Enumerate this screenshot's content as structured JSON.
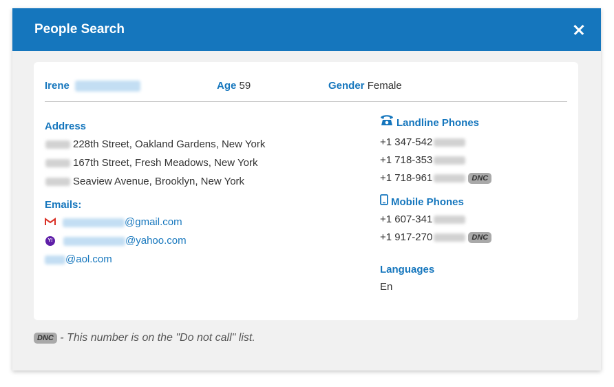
{
  "dialog": {
    "title": "People Search",
    "close_icon": "close-icon"
  },
  "person": {
    "first_name": "Irene",
    "age_label": "Age",
    "age": "59",
    "gender_label": "Gender",
    "gender": "Female"
  },
  "address": {
    "title": "Address",
    "lines": [
      "228th Street, Oakland Gardens, New York",
      "167th Street, Fresh Meadows, New York",
      "Seaview Avenue, Brooklyn, New York"
    ]
  },
  "emails": {
    "title": "Emails:",
    "items": [
      {
        "icon": "gmail-icon",
        "domain": "@gmail.com"
      },
      {
        "icon": "yahoo-icon",
        "domain": "@yahoo.com"
      },
      {
        "icon": "",
        "domain": "@aol.com"
      }
    ]
  },
  "landline": {
    "title": "Landline Phones",
    "icon": "telephone-icon",
    "numbers": [
      {
        "prefix": "+1 347-542",
        "dnc": false
      },
      {
        "prefix": "+1 718-353",
        "dnc": false
      },
      {
        "prefix": "+1 718-961",
        "dnc": true
      }
    ]
  },
  "mobile": {
    "title": "Mobile Phones",
    "icon": "mobile-phone-icon",
    "numbers": [
      {
        "prefix": "+1 607-341",
        "dnc": false
      },
      {
        "prefix": "+1 917-270",
        "dnc": true
      }
    ]
  },
  "languages": {
    "title": "Languages",
    "value": "En"
  },
  "dnc_label": "DNC",
  "footnote": "- This number is on the \"Do not call\" list.",
  "colors": {
    "header": "#1576bd",
    "accent": "#1576bd",
    "dialog_bg": "#f1f1f1",
    "dnc_badge": "#a9a9a9"
  }
}
